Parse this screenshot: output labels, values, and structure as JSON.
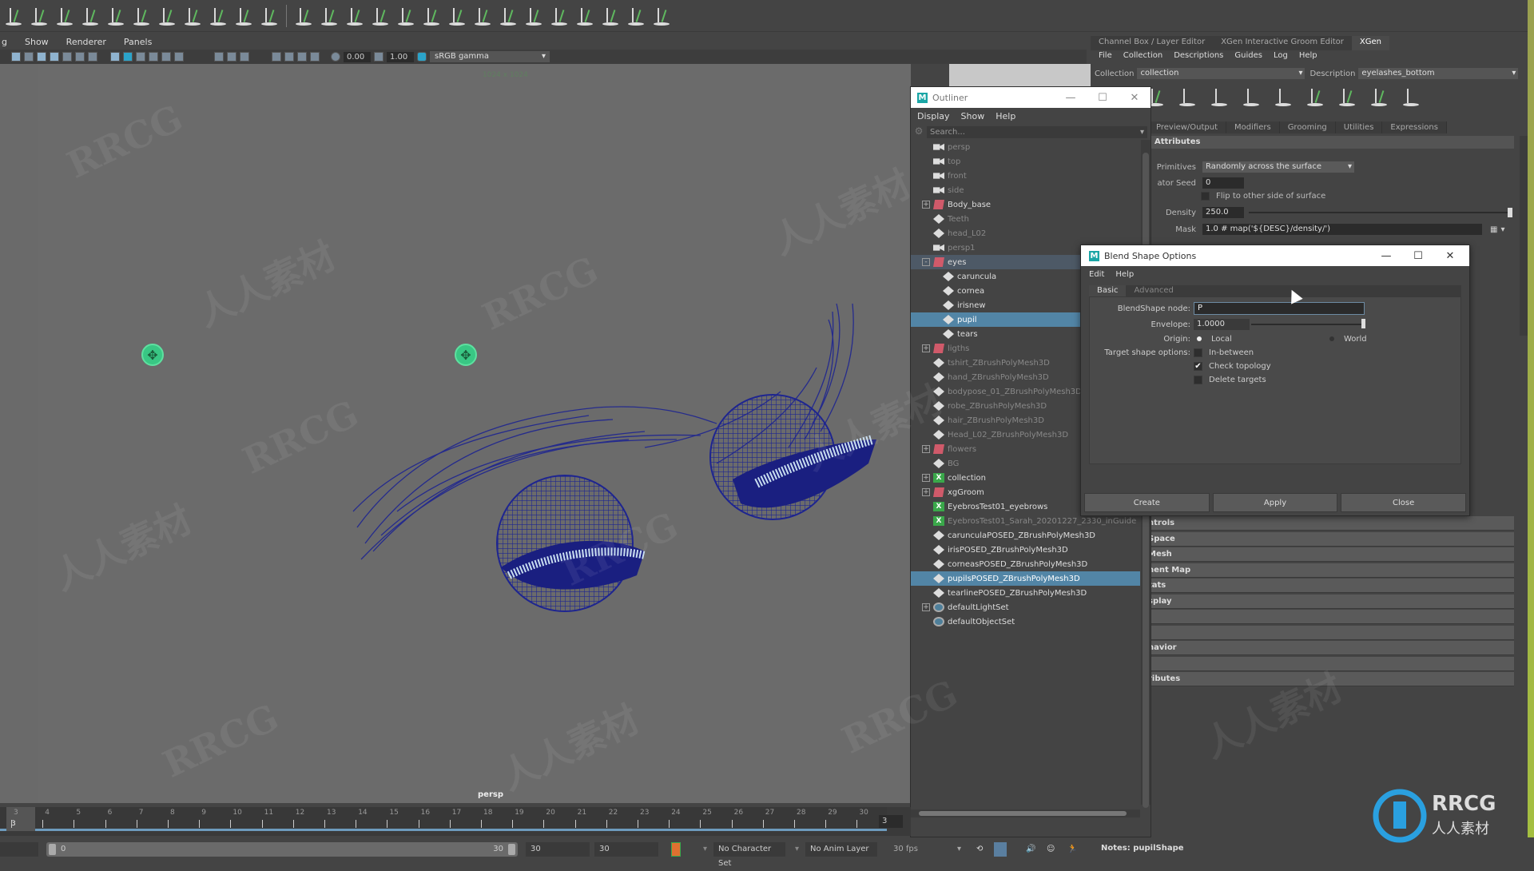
{
  "viewport": {
    "menu": [
      "g",
      "Show",
      "Renderer",
      "Panels"
    ],
    "exposure": "0.00",
    "gamma": "1.00",
    "color_space": "sRGB gamma",
    "resolution_gate": "1024 x 1024",
    "camera_label": "persp"
  },
  "outliner": {
    "title": "Outliner",
    "menu": [
      "Display",
      "Show",
      "Help"
    ],
    "search_placeholder": "Search...",
    "items": [
      {
        "label": "persp",
        "icon": "camera-icon",
        "dim": true,
        "indent": 1
      },
      {
        "label": "top",
        "icon": "camera-icon",
        "dim": true,
        "indent": 1
      },
      {
        "label": "front",
        "icon": "camera-icon",
        "dim": true,
        "indent": 1
      },
      {
        "label": "side",
        "icon": "camera-icon",
        "dim": true,
        "indent": 1
      },
      {
        "label": "Body_base",
        "icon": "group-icon",
        "expander": "+",
        "indent": 0
      },
      {
        "label": "Teeth",
        "icon": "mesh-icon",
        "dim": true,
        "indent": 1
      },
      {
        "label": "head_L02",
        "icon": "mesh-icon",
        "dim": true,
        "indent": 1
      },
      {
        "label": "persp1",
        "icon": "camera-icon",
        "dim": true,
        "indent": 1
      },
      {
        "label": "eyes",
        "icon": "group-icon",
        "expander": "-",
        "indent": 0,
        "parent_highlight": true
      },
      {
        "label": "caruncula",
        "icon": "mesh-icon",
        "indent": 2
      },
      {
        "label": "cornea",
        "icon": "mesh-icon",
        "indent": 2
      },
      {
        "label": "irisnew",
        "icon": "mesh-icon",
        "indent": 2
      },
      {
        "label": "pupil",
        "icon": "mesh-icon",
        "indent": 2,
        "selected": true
      },
      {
        "label": "tears",
        "icon": "mesh-icon",
        "indent": 2
      },
      {
        "label": "ligths",
        "icon": "group-icon",
        "expander": "+",
        "dim": true,
        "indent": 0
      },
      {
        "label": "tshirt_ZBrushPolyMesh3D",
        "icon": "mesh-icon",
        "dim": true,
        "indent": 1
      },
      {
        "label": "hand_ZBrushPolyMesh3D",
        "icon": "mesh-icon",
        "dim": true,
        "indent": 1
      },
      {
        "label": "bodypose_01_ZBrushPolyMesh3D",
        "icon": "mesh-icon",
        "dim": true,
        "indent": 1
      },
      {
        "label": "robe_ZBrushPolyMesh3D",
        "icon": "mesh-icon",
        "dim": true,
        "indent": 1
      },
      {
        "label": "hair_ZBrushPolyMesh3D",
        "icon": "mesh-icon",
        "dim": true,
        "indent": 1
      },
      {
        "label": "Head_L02_ZBrushPolyMesh3D",
        "icon": "mesh-icon",
        "dim": true,
        "indent": 1
      },
      {
        "label": "flowers",
        "icon": "group-icon",
        "expander": "+",
        "dim": true,
        "indent": 0
      },
      {
        "label": "BG",
        "icon": "mesh-icon",
        "dim": true,
        "indent": 1
      },
      {
        "label": "collection",
        "icon": "xgen-icon",
        "expander": "+",
        "indent": 0
      },
      {
        "label": "xgGroom",
        "icon": "group-icon",
        "expander": "+",
        "indent": 0
      },
      {
        "label": "EyebrosTest01_eyebrows",
        "icon": "xgen-icon",
        "indent": 1
      },
      {
        "label": "EyebrosTest01_Sarah_20201227_2330_inGuide",
        "icon": "xgen-icon",
        "dim": true,
        "indent": 1
      },
      {
        "label": "carunculaPOSED_ZBrushPolyMesh3D",
        "icon": "mesh-icon",
        "indent": 1
      },
      {
        "label": "irisPOSED_ZBrushPolyMesh3D",
        "icon": "mesh-icon",
        "indent": 1
      },
      {
        "label": "corneasPOSED_ZBrushPolyMesh3D",
        "icon": "mesh-icon",
        "indent": 1
      },
      {
        "label": "pupilsPOSED_ZBrushPolyMesh3D",
        "icon": "mesh-icon",
        "indent": 1,
        "selected": true
      },
      {
        "label": "tearlinePOSED_ZBrushPolyMesh3D",
        "icon": "mesh-icon",
        "indent": 1
      },
      {
        "label": "defaultLightSet",
        "icon": "set-icon",
        "expander": "+",
        "indent": 0
      },
      {
        "label": "defaultObjectSet",
        "icon": "set-icon",
        "indent": 1
      }
    ]
  },
  "xgen": {
    "tabs": [
      "Channel Box / Layer Editor",
      "XGen Interactive Groom Editor",
      "XGen"
    ],
    "active_tab": "XGen",
    "menu": [
      "File",
      "Collection",
      "Descriptions",
      "Guides",
      "Log",
      "Help"
    ],
    "collection_label": "Collection",
    "collection_value": "collection",
    "description_label": "Description",
    "description_value": "eyelashes_bottom",
    "subtabs": [
      "Preview/Output",
      "Modifiers",
      "Grooming",
      "Utilities",
      "Expressions"
    ],
    "attributes_header": "Attributes",
    "primitives_label": "Primitives",
    "primitives_value": "Randomly across the surface",
    "seed_label": "ator Seed",
    "seed_value": "0",
    "flip_label": "Flip to other side of surface",
    "density_label": "Density",
    "density_value": "250.0",
    "density_slider_fraction": 1.0,
    "mask_label": "Mask",
    "mask_value": "1.0 # map('${DESC}/density/')",
    "sections": [
      "ntrols",
      "Space",
      "Mesh",
      "nent Map",
      "tats",
      "splay",
      "",
      "",
      "navior",
      "",
      "ributes"
    ]
  },
  "blend_shape": {
    "title": "Blend Shape Options",
    "menu": [
      "Edit",
      "Help"
    ],
    "tabs": [
      "Basic",
      "Advanced"
    ],
    "active_tab": "Basic",
    "node_label": "BlendShape node:",
    "node_value": "P",
    "envelope_label": "Envelope:",
    "envelope_value": "1.0000",
    "envelope_fraction": 1.0,
    "origin_label": "Origin:",
    "origin_local": "Local",
    "origin_world": "World",
    "origin_selected": "Local",
    "target_label": "Target shape options:",
    "in_between": "In-between",
    "in_between_checked": false,
    "check_topology": "Check topology",
    "check_topology_checked": true,
    "delete_targets": "Delete targets",
    "delete_targets_checked": false,
    "create": "Create",
    "apply": "Apply",
    "close": "Close"
  },
  "timeline": {
    "ticks": [
      "3",
      "4",
      "5",
      "6",
      "7",
      "8",
      "9",
      "10",
      "11",
      "12",
      "13",
      "14",
      "15",
      "16",
      "17",
      "18",
      "19",
      "20",
      "21",
      "22",
      "23",
      "24",
      "25",
      "26",
      "27",
      "28",
      "29",
      "30"
    ],
    "current_frame": "3",
    "current_frame_field": "3",
    "range_start": "0",
    "range_end": "30",
    "playback_start": "30",
    "playback_end": "30",
    "character_set": "No Character Set",
    "anim_layer": "No Anim Layer",
    "fps": "30 fps",
    "notes": "Notes: pupilShape"
  },
  "watermark": {
    "brand": "RRCG",
    "sub": "人人素材"
  },
  "colors": {
    "selection": "#5285a6",
    "xgen_green": "#3aa84a",
    "timeline_accent": "#6d9bbd",
    "locator": "#39c784",
    "wire": "#1e2590",
    "lash": "#c8ddf0"
  }
}
